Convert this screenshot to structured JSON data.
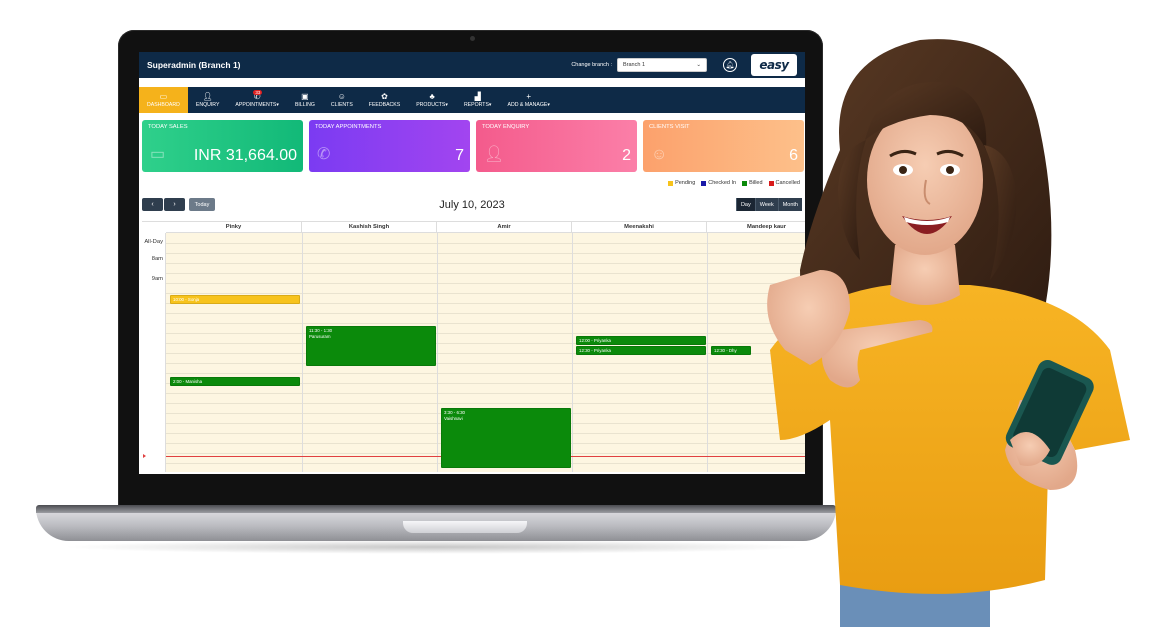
{
  "app": {
    "title": "Superadmin (Branch 1)",
    "change_branch_label": "Change branch :",
    "branch_value": "Branch 1",
    "logo_text": "easy",
    "notifications_icon": "bell-icon"
  },
  "nav": {
    "items": [
      {
        "label": "DASHBOARD",
        "icon": "dashboard-icon"
      },
      {
        "label": "ENQUIRY",
        "icon": "user-plus-icon"
      },
      {
        "label": "APPOINTMENTS",
        "icon": "phone-icon",
        "badge": "33"
      },
      {
        "label": "BILLING",
        "icon": "billing-icon"
      },
      {
        "label": "CLIENTS",
        "icon": "smiley-icon"
      },
      {
        "label": "FEEDBACKS",
        "icon": "gear-icon"
      },
      {
        "label": "PRODUCTS",
        "icon": "products-icon"
      },
      {
        "label": "REPORTS",
        "icon": "bar-chart-icon"
      },
      {
        "label": "ADD & MANAGE",
        "icon": "plus-icon"
      }
    ]
  },
  "cards": [
    {
      "title": "TODAY SALES",
      "value": "INR 31,664.00",
      "icon": "card-icon"
    },
    {
      "title": "TODAY APPOINTMENTS",
      "value": "7",
      "icon": "phone-icon"
    },
    {
      "title": "TODAY ENQUIRY",
      "value": "2",
      "icon": "user-plus-icon"
    },
    {
      "title": "CLIENTS VISIT",
      "value": "6",
      "icon": "smiley-icon"
    }
  ],
  "legend": [
    {
      "label": "Pending",
      "color": "#f7c31c"
    },
    {
      "label": "Checked In",
      "color": "#1a1aa8"
    },
    {
      "label": "Billed",
      "color": "#0b8a0b"
    },
    {
      "label": "Cancelled",
      "color": "#d81b1b"
    }
  ],
  "calendar": {
    "prev": "‹",
    "next": "›",
    "today_label": "Today",
    "date_title": "July 10, 2023",
    "views": [
      "Day",
      "Week",
      "Month"
    ],
    "active_view": "Day",
    "staff": [
      "Pinky",
      "Kashish Singh",
      "Amir",
      "Meenakshi",
      "Mandeep kaur"
    ],
    "time_labels": [
      "All-Day",
      "8am",
      "9am"
    ],
    "events": [
      {
        "col": 0,
        "time": "10:00 - Sonja",
        "name": "",
        "status": "pending"
      },
      {
        "col": 1,
        "time": "11:30 - 1:30",
        "name": "Parusuram",
        "status": "billed"
      },
      {
        "col": 3,
        "time": "12:00 - Priyanka",
        "name": "",
        "status": "billed"
      },
      {
        "col": 3,
        "time": "12:30 - Priyanka",
        "name": "",
        "status": "billed"
      },
      {
        "col": 4,
        "time": "12:30 - Dhy",
        "name": "",
        "status": "billed"
      },
      {
        "col": 0,
        "time": "2:00 - Manisha",
        "name": "",
        "status": "billed"
      },
      {
        "col": 2,
        "time": "3:30 - 6:30",
        "name": "Vaishnavi",
        "status": "billed"
      }
    ]
  }
}
